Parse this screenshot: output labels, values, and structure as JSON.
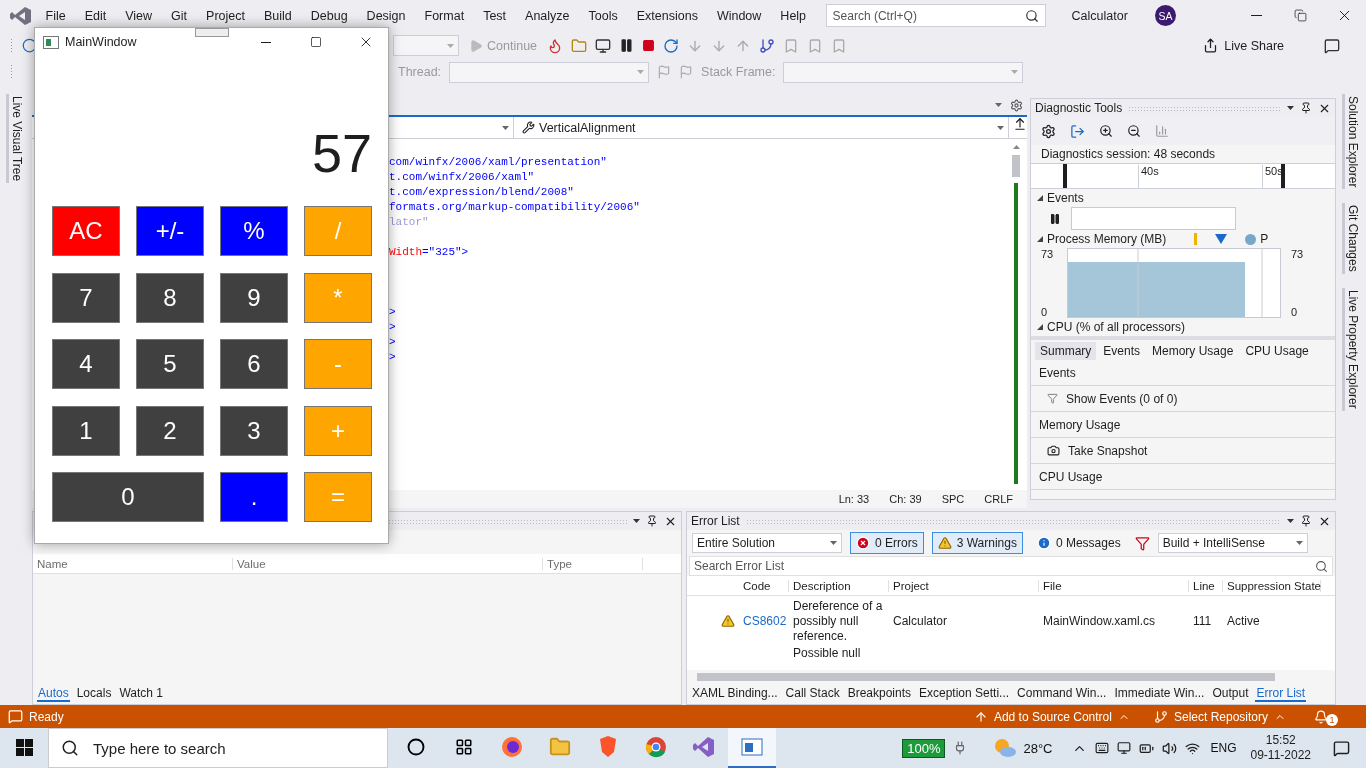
{
  "ide": {
    "menu": [
      "File",
      "Edit",
      "View",
      "Git",
      "Project",
      "Build",
      "Debug",
      "Design",
      "Format",
      "Test",
      "Analyze",
      "Tools",
      "Extensions",
      "Window",
      "Help"
    ],
    "search": {
      "placeholder": "Search (Ctrl+Q)"
    },
    "solution_name": "Calculator",
    "avatar": "SA",
    "toolbar": {
      "continue": "Continue",
      "live_share": "Live Share",
      "thread_label": "Thread:",
      "stack_frame_label": "Stack Frame:"
    },
    "left_tabs": [
      "Live Visual Tree"
    ],
    "right_tabs": [
      "Solution Explorer",
      "Git Changes",
      "Live Property Explorer"
    ]
  },
  "editor": {
    "member_dropdown": "VerticalAlignment",
    "code_lines": [
      {
        "kind": "code",
        "segments": [
          {
            "kind": "value",
            "text": "com/winfx/2006/xaml/presentation\""
          }
        ]
      },
      {
        "kind": "code",
        "segments": [
          {
            "kind": "value",
            "text": "t.com/winfx/2006/xaml\""
          }
        ]
      },
      {
        "kind": "code",
        "segments": [
          {
            "kind": "value",
            "text": "t.com/expression/blend/2008\""
          }
        ]
      },
      {
        "kind": "code",
        "segments": [
          {
            "kind": "value",
            "text": "formats.org/markup-compatibility/2006\""
          }
        ]
      },
      {
        "kind": "code",
        "segments": [
          {
            "kind": "faded",
            "text": "lator\""
          }
        ]
      },
      {
        "kind": "blank"
      },
      {
        "kind": "code",
        "segments": [
          {
            "kind": "attribute",
            "text": "Width"
          },
          {
            "kind": "value",
            "text": "=\"325\">"
          }
        ]
      },
      {
        "kind": "blank"
      },
      {
        "kind": "blank"
      },
      {
        "kind": "blank"
      },
      {
        "kind": "code",
        "segments": [
          {
            "kind": "value",
            "text": ">"
          }
        ]
      },
      {
        "kind": "code",
        "segments": [
          {
            "kind": "value",
            "text": ">"
          }
        ]
      },
      {
        "kind": "code",
        "segments": [
          {
            "kind": "value",
            "text": ">"
          }
        ]
      },
      {
        "kind": "code",
        "segments": [
          {
            "kind": "value",
            "text": ">"
          }
        ]
      }
    ],
    "status": {
      "line": "Ln: 33",
      "column": "Ch: 39",
      "indent": "SPC",
      "line_ending": "CRLF"
    }
  },
  "diagnostics": {
    "title": "Diagnostic Tools",
    "session": "Diagnostics session: 48 seconds",
    "ruler": [
      "40s",
      "50s"
    ],
    "events_header": "Events",
    "memory_header": "Process Memory (MB)",
    "memory_legend": "P",
    "memory_axis_left": {
      "max": "73",
      "min": "0"
    },
    "memory_axis_right": {
      "max": "73",
      "min": "0"
    },
    "cpu_header": "CPU (% of all processors)",
    "tabs": [
      {
        "label": "Summary",
        "selected": true
      },
      {
        "label": "Events",
        "selected": false
      },
      {
        "label": "Memory Usage",
        "selected": false
      },
      {
        "label": "CPU Usage",
        "selected": false
      }
    ],
    "summary": [
      {
        "kind": "header",
        "text": "Events"
      },
      {
        "kind": "events",
        "text": "Show Events (0 of 0)"
      },
      {
        "kind": "header",
        "text": "Memory Usage"
      },
      {
        "kind": "snapshot",
        "text": "Take Snapshot"
      },
      {
        "kind": "header",
        "text": "CPU Usage"
      }
    ]
  },
  "autos": {
    "columns": [
      "Name",
      "Value",
      "Type"
    ],
    "tabs": [
      {
        "label": "Autos",
        "selected": true
      },
      {
        "label": "Locals",
        "selected": false
      },
      {
        "label": "Watch 1",
        "selected": false
      }
    ]
  },
  "error_list": {
    "title": "Error List",
    "scope": "Entire Solution",
    "filters": [
      {
        "kind": "error",
        "label": "0 Errors",
        "selected": true
      },
      {
        "kind": "warning",
        "label": "3 Warnings",
        "selected": true
      },
      {
        "kind": "message",
        "label": "0 Messages",
        "selected": false
      }
    ],
    "source": "Build + IntelliSense",
    "search": {
      "placeholder": "Search Error List"
    },
    "columns": [
      "Code",
      "Description",
      "Project",
      "File",
      "Line",
      "Suppression State"
    ],
    "rows": [
      {
        "kind": "warning",
        "code": "CS8602",
        "description": "Dereference of a possibly null reference.",
        "project": "Calculator",
        "file": "MainWindow.xaml.cs",
        "line": "111",
        "state": "Active"
      },
      {
        "kind": "partial",
        "description": "Possible null"
      }
    ],
    "tabs": [
      {
        "label": "XAML Binding...",
        "selected": false
      },
      {
        "label": "Call Stack",
        "selected": false
      },
      {
        "label": "Breakpoints",
        "selected": false
      },
      {
        "label": "Exception Setti...",
        "selected": false
      },
      {
        "label": "Command Win...",
        "selected": false
      },
      {
        "label": "Immediate Win...",
        "selected": false
      },
      {
        "label": "Output",
        "selected": false
      },
      {
        "label": "Error List",
        "selected": true
      }
    ]
  },
  "status_bar": {
    "state": "Ready",
    "source_control": "Add to Source Control",
    "repository": "Select Repository",
    "notifications": "1"
  },
  "taskbar": {
    "search_placeholder": "Type here to search",
    "battery": "100%",
    "temperature": "28°C",
    "language": "ENG",
    "time": "15:52",
    "date": "09-11-2022"
  },
  "calculator": {
    "title": "MainWindow",
    "display": "57",
    "buttons": [
      {
        "label": "AC",
        "color": "#ff0000",
        "wide": false
      },
      {
        "label": "+/-",
        "color": "#0000ff",
        "wide": false
      },
      {
        "label": "%",
        "color": "#0000ff",
        "wide": false
      },
      {
        "label": "/",
        "color": "#ffa500",
        "wide": false
      },
      {
        "label": "7",
        "color": "#404040",
        "wide": false
      },
      {
        "label": "8",
        "color": "#404040",
        "wide": false
      },
      {
        "label": "9",
        "color": "#404040",
        "wide": false
      },
      {
        "label": "*",
        "color": "#ffa500",
        "wide": false
      },
      {
        "label": "4",
        "color": "#404040",
        "wide": false
      },
      {
        "label": "5",
        "color": "#404040",
        "wide": false
      },
      {
        "label": "6",
        "color": "#404040",
        "wide": false
      },
      {
        "label": "-",
        "color": "#ffa500",
        "wide": false
      },
      {
        "label": "1",
        "color": "#404040",
        "wide": false
      },
      {
        "label": "2",
        "color": "#404040",
        "wide": false
      },
      {
        "label": "3",
        "color": "#404040",
        "wide": false
      },
      {
        "label": "+",
        "color": "#ffa500",
        "wide": false
      },
      {
        "label": "0",
        "color": "#404040",
        "wide": true
      },
      {
        "label": ".",
        "color": "#0000ff",
        "wide": false
      },
      {
        "label": "=",
        "color": "#ffa500",
        "wide": false
      }
    ]
  }
}
